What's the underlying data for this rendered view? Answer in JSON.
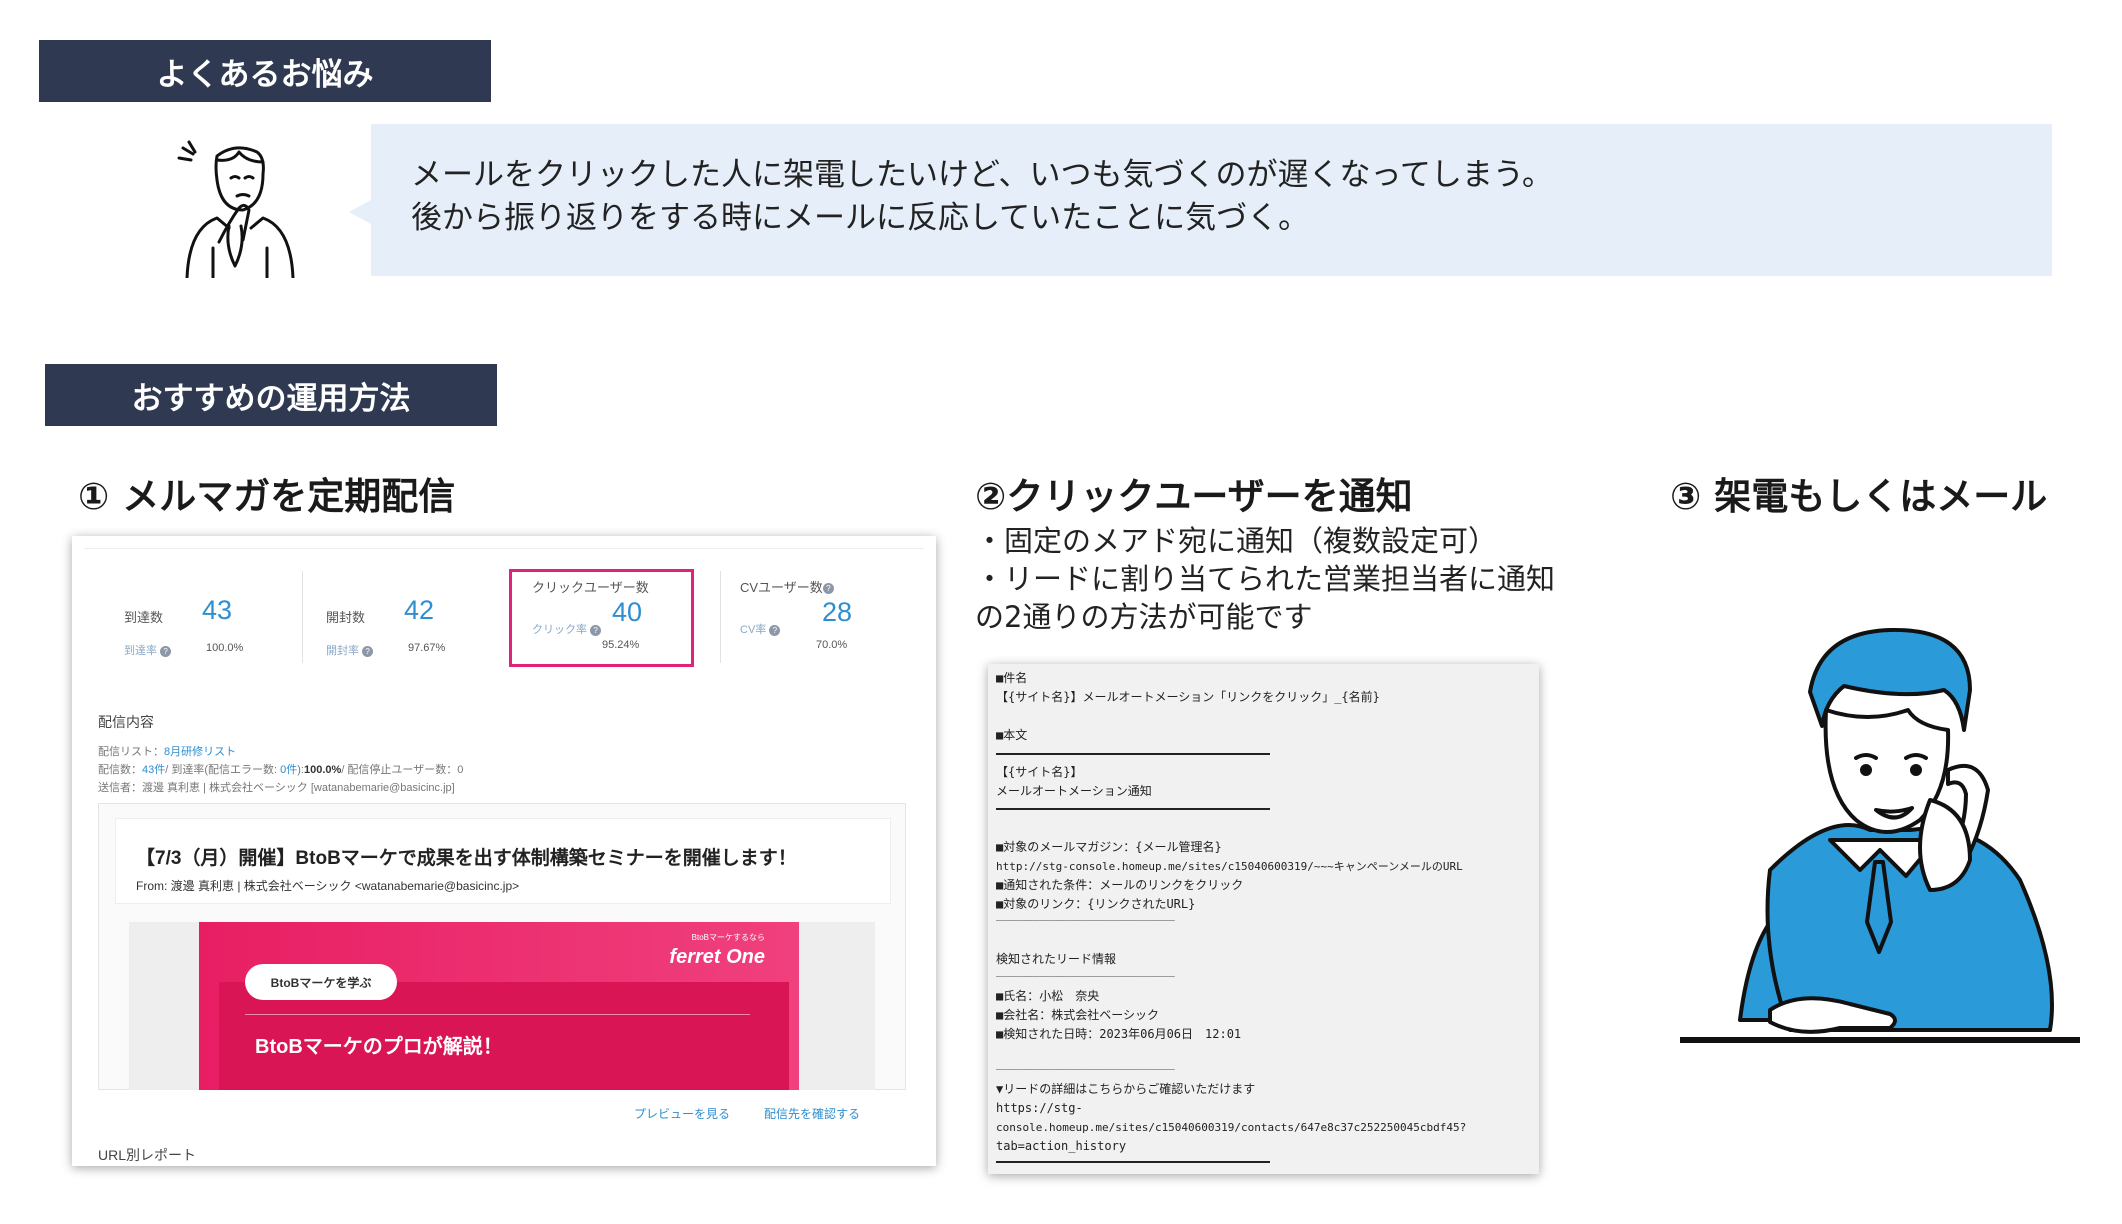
{
  "worries": {
    "header": "よくあるお悩み",
    "line1": "メールをクリックした人に架電したいけど、いつも気づくのが遅くなってしまう。",
    "line2": "後から振り返りをする時にメールに反応していたことに気づく。"
  },
  "method": {
    "header": "おすすめの運用方法",
    "step1_title": "① メルマガを定期配信",
    "step2_title": "②クリックユーザーを通知",
    "step3_title": "③ 架電もしくはメール",
    "step2_desc": [
      "・固定のメアド宛に通知（複数設定可）",
      "・リードに割り当てられた営業担当者に通知",
      "の2通りの方法が可能です"
    ]
  },
  "dashboard": {
    "metrics": [
      {
        "label": "到達数",
        "value": "43",
        "sub_label": "到達率",
        "sub_value": "100.0%"
      },
      {
        "label": "開封数",
        "value": "42",
        "sub_label": "開封率",
        "sub_value": "97.67%"
      },
      {
        "label": "クリックユーザー数",
        "value": "40",
        "sub_label": "クリック率",
        "sub_value": "95.24%"
      },
      {
        "label": "CVユーザー数",
        "value": "28",
        "sub_label": "CV率",
        "sub_value": "70.0%"
      }
    ],
    "delivery_content_label": "配信内容",
    "list_prefix": "配信リスト：",
    "list_name": "8月研修リスト",
    "counts_prefix": "配信数：",
    "counts_sent": "43件",
    "counts_mid": "/ 到達率(配信エラー数: ",
    "counts_errors": "0件",
    "counts_close": "):",
    "counts_rate": "100.0%",
    "counts_suffix": "/ 配信停止ユーザー数：0",
    "sender": "送信者：渡邊 真利恵 | 株式会社ベーシック [watanabemarie@basicinc.jp]",
    "email_subject": "【7/3（月）開催】BtoBマーケで成果を出す体制構築セミナーを開催します！",
    "email_from": "From: 渡邊 真利恵 | 株式会社ベーシック <watanabemarie@basicinc.jp>",
    "banner_small": "BtoBマーケするなら",
    "banner_brand": "ferret One",
    "banner_pill": "BtoBマーケを学ぶ",
    "banner_headline": "BtoBマーケのプロが解説！",
    "preview_link": "プレビューを見る",
    "recipients_link": "配信先を確認する",
    "url_report": "URL別レポート"
  },
  "notification_email": {
    "rows": [
      "■件名",
      "【{サイト名}】メールオートメーション「リンクをクリック」_{名前}",
      "",
      "■本文",
      "",
      "【{サイト名}】",
      "メールオートメーション通知",
      "",
      "",
      "■対象のメールマガジン：{メール管理名}",
      "http://stg-console.homeup.me/sites/c15040600319/~~~キャンペーンメールのURL",
      "■通知された条件：メールのリンクをクリック",
      "■対象のリンク：{リンクされたURL}",
      "―――――――――――――――――――――――――――――――――",
      "",
      "検知されたリード情報",
      "―――――――――――――――――――――――――――――――――",
      "■氏名：小松　奈央",
      "■会社名：株式会社ベーシック",
      "■検知された日時：2023年06月06日　12:01",
      "",
      "―――――――――――――――――――――――――――――――――",
      "▼リードの詳細はこちらからご確認いただけます",
      "https://stg-",
      "console.homeup.me/sites/c15040600319/contacts/647e8c37c252250045cbdf45?",
      "tab=action_history"
    ]
  },
  "colors": {
    "header_bg": "#2f3a52",
    "bubble_bg": "#e5eef9",
    "metric_blue": "#2e8ecf",
    "highlight": "#e0237a",
    "suit_blue": "#2a9ad9"
  }
}
